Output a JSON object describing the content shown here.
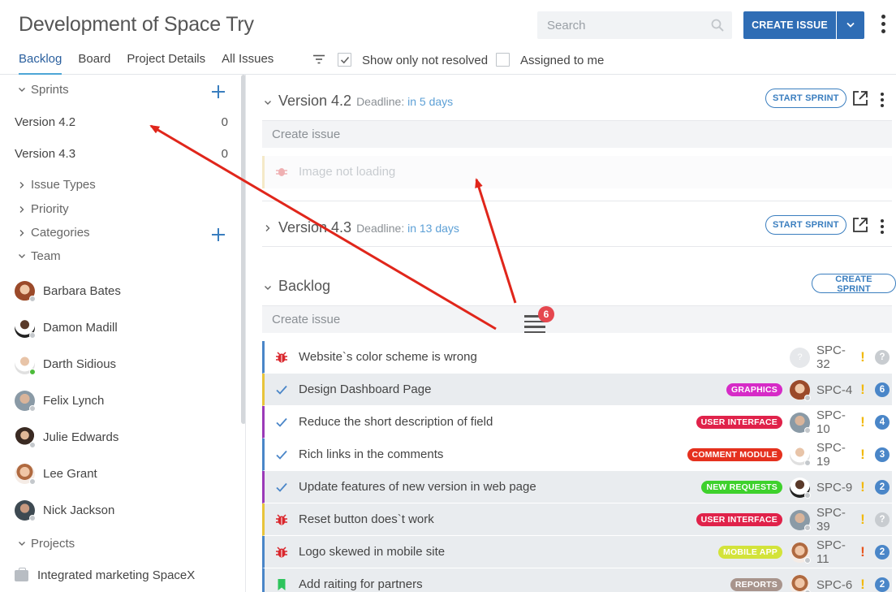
{
  "header": {
    "project_title": "Development of Space Try",
    "search_placeholder": "Search",
    "create_label": "CREATE ISSUE",
    "tabs": [
      {
        "label": "Backlog",
        "active": true
      },
      {
        "label": "Board"
      },
      {
        "label": "Project Details"
      },
      {
        "label": "All Issues"
      }
    ],
    "filter_resolved": {
      "label": "Show only not resolved",
      "checked": true
    },
    "filter_assigned": {
      "label": "Assigned to me",
      "checked": false
    }
  },
  "sidebar": {
    "sprints_label": "Sprints",
    "sprints": [
      {
        "name": "Version 4.2",
        "count": "0"
      },
      {
        "name": "Version 4.3",
        "count": "0"
      }
    ],
    "issue_types_label": "Issue Types",
    "priority_label": "Priority",
    "categories_label": "Categories",
    "team_label": "Team",
    "team": [
      {
        "name": "Barbara Bates"
      },
      {
        "name": "Damon Madill"
      },
      {
        "name": "Darth Sidious"
      },
      {
        "name": "Felix Lynch"
      },
      {
        "name": "Julie Edwards"
      },
      {
        "name": "Lee Grant"
      },
      {
        "name": "Nick Jackson"
      }
    ],
    "projects_label": "Projects",
    "projects": [
      {
        "name": "Integrated marketing SpaceX"
      }
    ]
  },
  "main": {
    "sprint1": {
      "name": "Version 4.2",
      "deadline_label": "Deadline:",
      "deadline_value": "in 5 days",
      "action": "START SPRINT"
    },
    "create_issue_placeholder": "Create issue",
    "placeholder_issue": "Image not loading",
    "sprint2": {
      "name": "Version 4.3",
      "deadline_label": "Deadline:",
      "deadline_value": "in 13 days",
      "action": "START SPRINT"
    },
    "backlog": {
      "name": "Backlog",
      "action": "CREATE SPRINT"
    },
    "notification_count": "6",
    "issues": [
      {
        "type": "bug",
        "title": "Website`s color scheme is wrong",
        "label": "",
        "key": "SPC-32",
        "priority": "!",
        "estimate": "?"
      },
      {
        "type": "task",
        "title": "Design Dashboard Page",
        "label": "GRAPHICS",
        "key": "SPC-4",
        "priority": "!",
        "estimate": "6"
      },
      {
        "type": "task",
        "title": "Reduce the short description of field",
        "label": "USER INTERFACE",
        "key": "SPC-10",
        "priority": "!",
        "estimate": "4"
      },
      {
        "type": "task",
        "title": "Rich links in the comments",
        "label": "COMMENT MODULE",
        "key": "SPC-19",
        "priority": "!",
        "estimate": "3"
      },
      {
        "type": "task",
        "title": "Update features of new version in web page",
        "label": "NEW REQUESTS",
        "key": "SPC-9",
        "priority": "!",
        "estimate": "2"
      },
      {
        "type": "bug",
        "title": "Reset button does`t work",
        "label": "USER INTERFACE",
        "key": "SPC-39",
        "priority": "!",
        "estimate": "?"
      },
      {
        "type": "bug",
        "title": "Logo skewed in mobile site",
        "label": "MOBILE APP",
        "key": "SPC-11",
        "priority": "!",
        "estimate": "2"
      },
      {
        "type": "story",
        "title": "Add raiting for partners",
        "label": "REPORTS",
        "key": "SPC-6",
        "priority": "!",
        "estimate": "2"
      }
    ]
  },
  "colors": {
    "primary": "#2f6db5",
    "link": "#3a7ebf",
    "bug": "#d9262c",
    "graphics": "#d62bc7",
    "user_interface": "#e0224a",
    "comment_module": "#e5311e",
    "new_requests": "#3ed12c",
    "mobile_app": "#d3e33a",
    "reports": "#a8948c",
    "priority_medium": "#f2b90c",
    "priority_high": "#e8551e",
    "annotation_arrow": "#e0261b"
  }
}
